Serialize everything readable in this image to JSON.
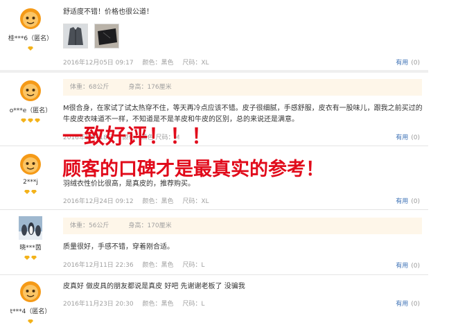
{
  "reviews": [
    {
      "user": "桂***6（匿名）",
      "gems": 1,
      "text": "舒适度不错！价格也很公道！",
      "date": "2016年12月05日 09:17",
      "color": "颜色：黑色",
      "size": "尺码：XL",
      "useful": "有用",
      "useful_count": "(0)"
    },
    {
      "user": "o***e（匿名）",
      "gems": 3,
      "weight": "体重：68公斤",
      "height": "身高：176厘米",
      "text": "M很合身，在家试了试太热穿不住，等天再冷点应该不错。皮子很细腻，手感舒服，皮衣有一股味儿，跟我之前买过的牛皮皮衣味道不一样，不知道是不是羊皮和牛皮的区别，总的来说还是满意。",
      "date_partial": "2016年12月18日 ",
      "meta_partial": "颜色：黑色  尺码：M",
      "useful": "有用",
      "useful_count": "(0)"
    },
    {
      "user": "2***j",
      "gems": 2,
      "text": "羽绒衣性价比很高，是真皮的，推荐购买。",
      "date": "2016年12月24日 09:12",
      "color": "颜色：黑色",
      "size": "尺码：XL",
      "useful": "有用",
      "useful_count": "(0)"
    },
    {
      "user": "晓***茵",
      "gems": 2,
      "weight": "体重：56公斤",
      "height": "身高：170厘米",
      "text": "质量很好，手感不错，穿着刚合适。",
      "date": "2016年12月11日 22:36",
      "color": "颜色：黑色",
      "size": "尺码：L",
      "useful": "有用",
      "useful_count": "(0)"
    },
    {
      "user": "t***4（匿名）",
      "gems": 1,
      "text": "皮真好 做皮具的朋友都说是真皮 好吧 先谢谢老板了 没骗我",
      "date": "2016年11月23日 20:30",
      "color": "颜色：黑色",
      "size": "尺码：L",
      "useful": "有用",
      "useful_count": "(0)"
    }
  ],
  "overlay": {
    "line1": "一致好评！！！",
    "line2": "顾客的口碑才是最真实的参考！"
  },
  "colors": {
    "overlay_red": "#e10b1b",
    "useful_blue": "#3a6fb5",
    "info_bg": "#fef6e9"
  }
}
